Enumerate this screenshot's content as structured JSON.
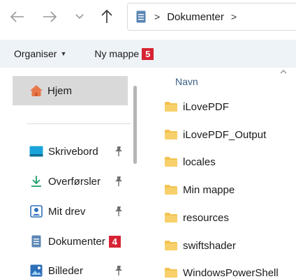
{
  "nav": {
    "back_icon": "arrow-left-icon",
    "forward_icon": "arrow-right-icon",
    "recent_icon": "chevron-down-icon",
    "up_icon": "arrow-up-icon"
  },
  "address": {
    "separator": ">",
    "current": "Dokumenter"
  },
  "command_bar": {
    "organise_label": "Organiser",
    "new_folder_label": "Ny mappe",
    "new_folder_badge": "5"
  },
  "sidebar": {
    "home_label": "Hjem",
    "items": [
      {
        "label": "Skrivebord",
        "icon": "desktop-icon",
        "pinned": true
      },
      {
        "label": "Overførsler",
        "icon": "download-icon",
        "pinned": true
      },
      {
        "label": "Mit drev",
        "icon": "drive-icon",
        "pinned": true
      },
      {
        "label": "Dokumenter",
        "icon": "documents-icon",
        "badge": "4"
      },
      {
        "label": "Billeder",
        "icon": "pictures-icon",
        "pinned": true
      }
    ]
  },
  "main": {
    "column_header": "Navn",
    "files": [
      "iLovePDF",
      "iLovePDF_Output",
      "locales",
      "Min mappe",
      "resources",
      "swiftshader",
      "WindowsPowerShell"
    ]
  },
  "colors": {
    "badge_red": "#d62333",
    "folder_yellow": "#f4c250",
    "selected_bg": "#d9d9d9",
    "command_bar_bg": "#eef3f8"
  }
}
